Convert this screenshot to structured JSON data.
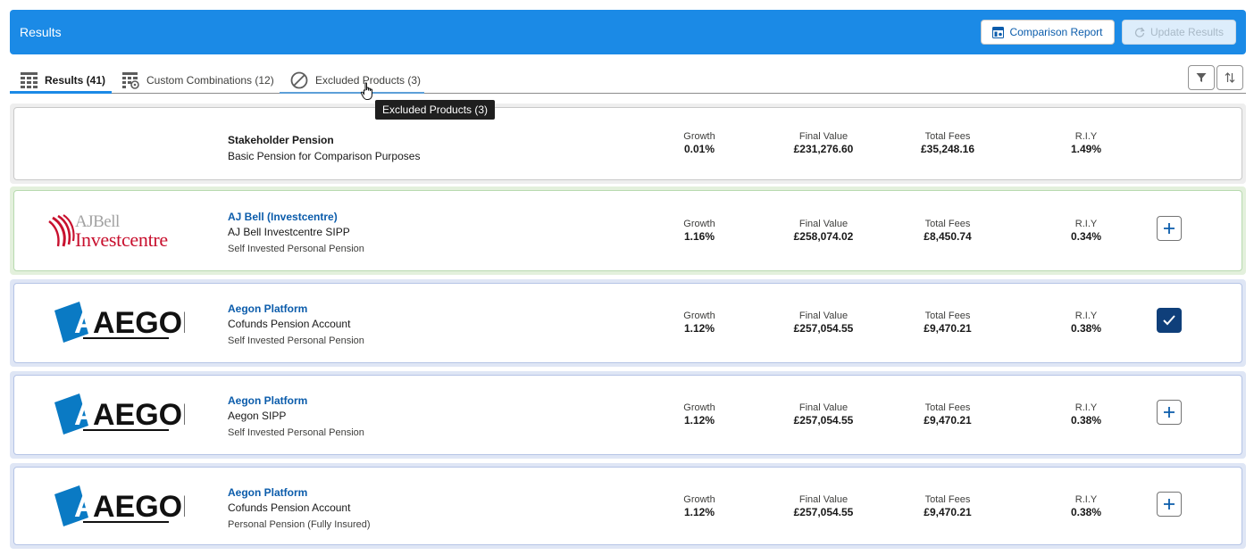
{
  "header": {
    "title": "Results",
    "comparison_report": "Comparison Report",
    "update_results": "Update Results"
  },
  "tabs": [
    {
      "label": "Results (41)",
      "icon": "table-icon"
    },
    {
      "label": "Custom Combinations (12)",
      "icon": "table-settings-icon"
    },
    {
      "label": "Excluded Products (3)",
      "icon": "block-icon"
    }
  ],
  "tooltip": "Excluded Products (3)",
  "stat_labels": {
    "growth": "Growth",
    "final_value": "Final Value",
    "total_fees": "Total Fees",
    "riy": "R.I.Y"
  },
  "results": [
    {
      "logo": "",
      "provider": "Stakeholder Pension",
      "product": "Basic Pension for Comparison Purposes",
      "type": "",
      "growth": "0.01%",
      "final_value": "£231,276.60",
      "total_fees": "£35,248.16",
      "riy": "1.49%",
      "selection": "none"
    },
    {
      "logo": "AJ Bell Investcentre",
      "logo_lines": [
        "AJBell",
        "Investcentre"
      ],
      "provider": "AJ Bell (Investcentre)",
      "product": "AJ Bell Investcentre SIPP",
      "type": "Self Invested Personal Pension",
      "growth": "1.16%",
      "final_value": "£258,074.02",
      "total_fees": "£8,450.74",
      "riy": "0.34%",
      "selection": "add"
    },
    {
      "logo": "AEGON",
      "provider": "Aegon Platform",
      "product": "Cofunds Pension Account",
      "type": "Self Invested Personal Pension",
      "growth": "1.12%",
      "final_value": "£257,054.55",
      "total_fees": "£9,470.21",
      "riy": "0.38%",
      "selection": "checked"
    },
    {
      "logo": "AEGON",
      "provider": "Aegon Platform",
      "product": "Aegon SIPP",
      "type": "Self Invested Personal Pension",
      "growth": "1.12%",
      "final_value": "£257,054.55",
      "total_fees": "£9,470.21",
      "riy": "0.38%",
      "selection": "add"
    },
    {
      "logo": "AEGON",
      "provider": "Aegon Platform",
      "product": "Cofunds Pension Account",
      "type": "Personal Pension (Fully Insured)",
      "growth": "1.12%",
      "final_value": "£257,054.55",
      "total_fees": "£9,470.21",
      "riy": "0.38%",
      "selection": "add"
    }
  ],
  "colors": {
    "header_bg": "#1b8ae6",
    "link": "#0b5cab",
    "checked_bg": "#0f3f7a",
    "ajbell_red": "#c8102e",
    "aegon_blue": "#0a7ac4"
  }
}
